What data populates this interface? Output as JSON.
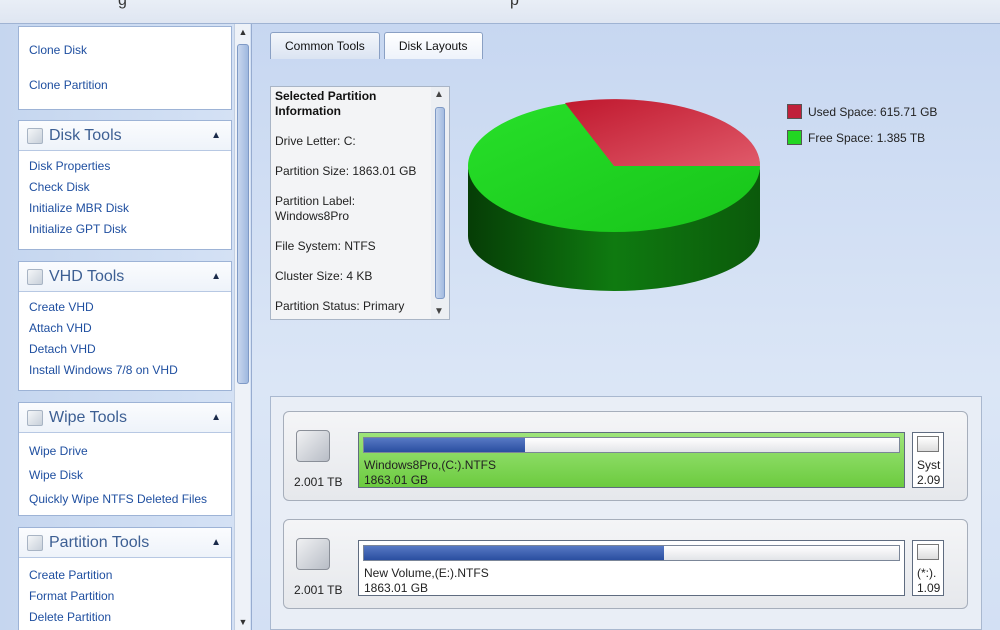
{
  "window": {
    "title_fragments": [
      "g",
      "p"
    ]
  },
  "sidebar": {
    "groups": [
      {
        "title": "",
        "items": [
          "Clone Disk",
          "Clone Partition"
        ]
      },
      {
        "title": "Disk Tools",
        "items": [
          "Disk Properties",
          "Check Disk",
          "Initialize MBR Disk",
          "Initialize GPT Disk"
        ]
      },
      {
        "title": "VHD Tools",
        "items": [
          "Create VHD",
          "Attach VHD",
          "Detach VHD",
          "Install Windows 7/8 on VHD"
        ]
      },
      {
        "title": "Wipe Tools",
        "items": [
          "Wipe Drive",
          "Wipe Disk",
          "Quickly Wipe NTFS Deleted Files"
        ]
      },
      {
        "title": "Partition Tools",
        "items": [
          "Create Partition",
          "Format Partition",
          "Delete Partition"
        ]
      }
    ]
  },
  "tabs": [
    "Common Tools",
    "Disk Layouts"
  ],
  "info": {
    "title": "Selected Partition Information",
    "rows": [
      "Drive Letter: C:",
      "Partition Size: 1863.01 GB",
      "Partition Label: Windows8Pro",
      "File System: NTFS",
      "Cluster Size: 4 KB",
      "Partition Status: Primary"
    ]
  },
  "legend": {
    "used": "Used Space: 615.71 GB",
    "free": "Free Space: 1.385 TB",
    "used_color": "#c0203a",
    "free_color": "#22d622"
  },
  "pie": {
    "used_fraction": 0.3,
    "free_fraction": 0.7
  },
  "disks": [
    {
      "size": "2.001 TB",
      "partition": {
        "label": "Windows8Pro,(C:).NTFS",
        "size": "1863.01 GB",
        "used_fraction": 0.3
      },
      "extra": {
        "line1": "Syst",
        "line2": "2.09"
      }
    },
    {
      "size": "2.001 TB",
      "partition": {
        "label": "New Volume,(E:).NTFS",
        "size": "1863.01 GB",
        "used_fraction": 0.56
      },
      "extra": {
        "line1": "(*:).",
        "line2": "1.09"
      }
    }
  ]
}
